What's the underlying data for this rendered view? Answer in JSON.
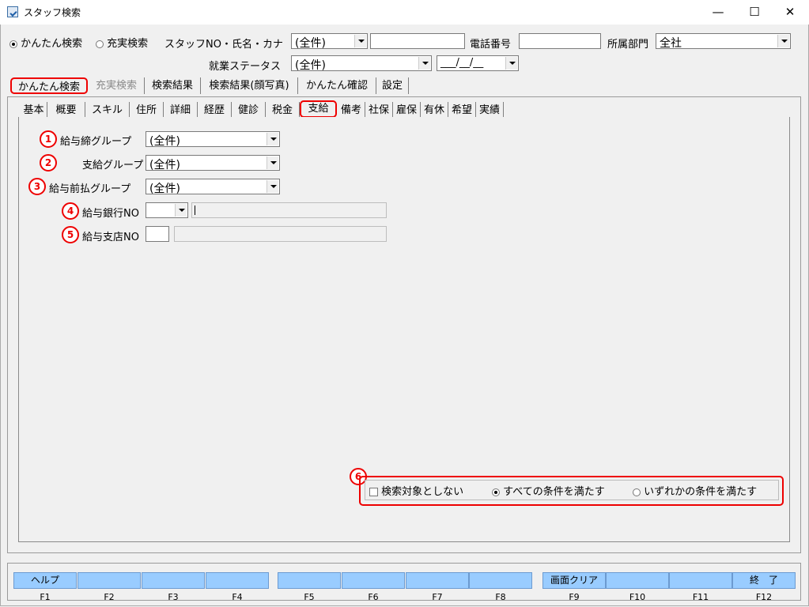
{
  "window": {
    "title": "スタッフ検索",
    "minimize": "—",
    "maximize": "☐",
    "close": "✕"
  },
  "search_mode": {
    "easy": "かんたん検索",
    "full": "充実検索",
    "selected": "easy"
  },
  "header": {
    "staff_label": "スタッフNO・氏名・カナ",
    "staff_combo_value": "(全件)",
    "staff_text_value": "",
    "phone_label": "電話番号",
    "phone_value": "",
    "dept_label": "所属部門",
    "dept_value": "全社",
    "status_label": "就業ステータス",
    "status_value": "(全件)",
    "date_value": "___/__/__"
  },
  "main_tabs": [
    {
      "label": "かんたん検索",
      "active": true
    },
    {
      "label": "充実検索",
      "disabled": true
    },
    {
      "label": "検索結果"
    },
    {
      "label": "検索結果(顔写真)"
    },
    {
      "label": "かんたん確認"
    },
    {
      "label": "設定"
    }
  ],
  "sub_tabs": [
    "基本",
    "概要",
    "スキル",
    "住所",
    "詳細",
    "経歴",
    "健診",
    "税金",
    "支給",
    "備考",
    "社保",
    "雇保",
    "有休",
    "希望",
    "実績"
  ],
  "active_sub_tab": "支給",
  "fields": {
    "f1": {
      "num": "1",
      "label": "給与締グループ",
      "value": "(全件)"
    },
    "f2": {
      "num": "2",
      "label": "支給グループ",
      "value": "(全件)"
    },
    "f3": {
      "num": "3",
      "label": "給与前払グループ",
      "value": "(全件)"
    },
    "f4": {
      "num": "4",
      "label": "給与銀行NO",
      "value": ""
    },
    "f5": {
      "num": "5",
      "label": "給与支店NO",
      "value": ""
    }
  },
  "conditions": {
    "num": "6",
    "exclude_label": "検索対象としない",
    "all_label": "すべての条件を満たす",
    "any_label": "いずれかの条件を満たす",
    "selected": "all"
  },
  "function_keys": [
    {
      "label": "ヘルプ",
      "key": "F1"
    },
    {
      "label": "",
      "key": "F2"
    },
    {
      "label": "",
      "key": "F3"
    },
    {
      "label": "",
      "key": "F4"
    },
    {
      "label": "",
      "key": "F5"
    },
    {
      "label": "",
      "key": "F6"
    },
    {
      "label": "",
      "key": "F7"
    },
    {
      "label": "",
      "key": "F8"
    },
    {
      "label": "画面クリア",
      "key": "F9"
    },
    {
      "label": "",
      "key": "F10"
    },
    {
      "label": "",
      "key": "F11"
    },
    {
      "label": "終　了",
      "key": "F12"
    }
  ],
  "colors": {
    "highlight": "#e00000",
    "fbutton": "#99ccff"
  }
}
